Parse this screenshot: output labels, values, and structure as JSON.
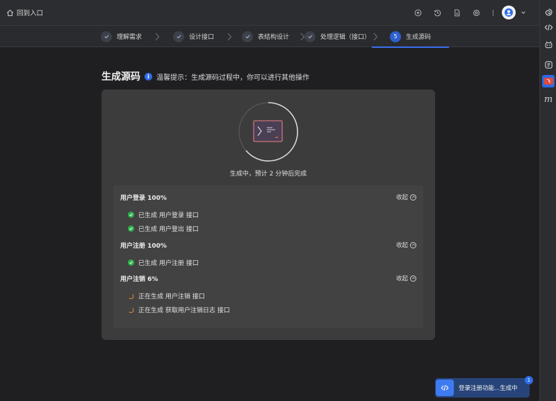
{
  "header": {
    "back_label": "回到入口",
    "tools": [
      "add-circle-icon",
      "history-icon",
      "document-icon",
      "settings-icon"
    ]
  },
  "steps": [
    {
      "label": "理解需求",
      "state": "done"
    },
    {
      "label": "设计接口",
      "state": "done"
    },
    {
      "label": "表结构设计",
      "state": "done"
    },
    {
      "label": "处理逻辑（接口）",
      "state": "done"
    },
    {
      "label": "生成源码",
      "state": "active",
      "number": "5"
    }
  ],
  "page": {
    "title": "生成源码",
    "tip": "温馨提示：生成源码过程中，你可以进行其他操作",
    "status": "生成中，预计 2 分钟后完成"
  },
  "groups": [
    {
      "title": "用户登录 100%",
      "collapse": "收起",
      "items": [
        {
          "text": "已生成 用户登录 接口",
          "state": "done"
        },
        {
          "text": "已生成 用户登出 接口",
          "state": "done"
        }
      ]
    },
    {
      "title": "用户注册 100%",
      "collapse": "收起",
      "items": [
        {
          "text": "已生成 用户注册 接口",
          "state": "done"
        }
      ]
    },
    {
      "title": "用户注销 6%",
      "collapse": "收起",
      "items": [
        {
          "text": "正在生成 用户注销 接口",
          "state": "loading"
        },
        {
          "text": "正在生成 获取用户注销日志 接口",
          "state": "loading"
        }
      ]
    }
  ],
  "toast": {
    "text": "登录注册功能...生成中",
    "badge": "1"
  },
  "rail": [
    "swirl-icon",
    "code-icon",
    "robot-icon",
    "app-icon",
    "m-icon"
  ],
  "colors": {
    "accent": "#3a6ff0",
    "success": "#2cb34a",
    "loading": "#e08a2c"
  }
}
